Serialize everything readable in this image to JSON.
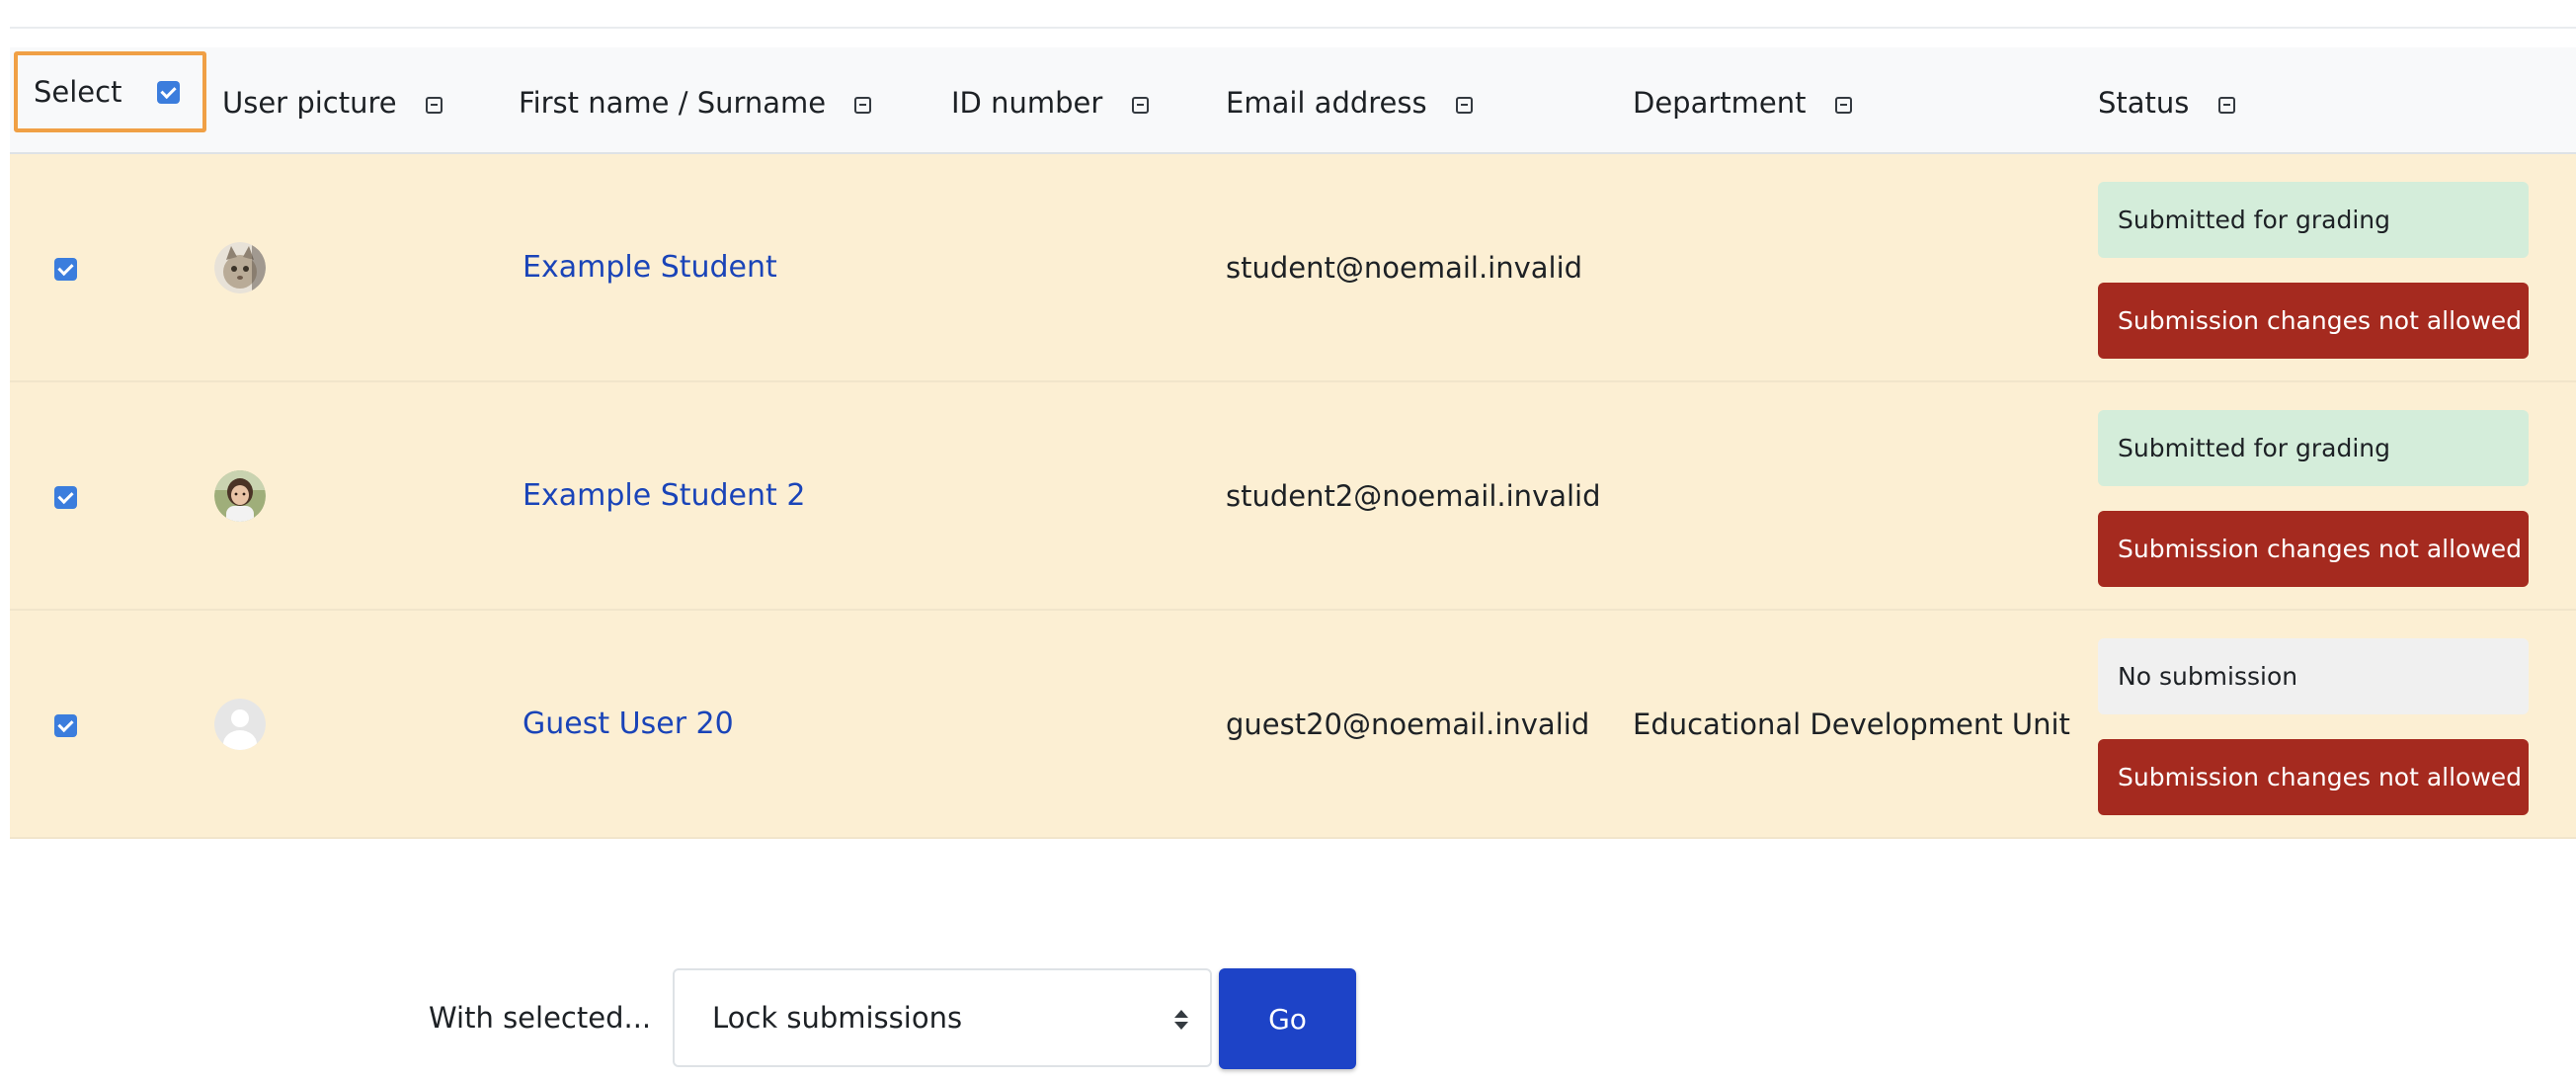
{
  "table": {
    "headers": {
      "select": "Select",
      "user_picture": "User picture",
      "name": "First name / Surname",
      "id_number": "ID number",
      "email": "Email address",
      "department": "Department",
      "status": "Status"
    },
    "rows": [
      {
        "name": "Example Student",
        "id_number": "",
        "email": "student@noemail.invalid",
        "department": "",
        "status": "Submitted for grading",
        "lock": "Submission changes not allowed",
        "avatar": "cat-avatar"
      },
      {
        "name": "Example Student 2",
        "id_number": "",
        "email": "student2@noemail.invalid",
        "department": "",
        "status": "Submitted for grading",
        "lock": "Submission changes not allowed",
        "avatar": "person-avatar"
      },
      {
        "name": "Guest User 20",
        "id_number": "",
        "email": "guest20@noemail.invalid",
        "department": "Educational Development Unit",
        "status": "No submission",
        "lock": "Submission changes not allowed",
        "avatar": "default-user-avatar"
      }
    ]
  },
  "bulk_actions": {
    "label": "With selected...",
    "selected_option": "Lock submissions",
    "go_label": "Go"
  },
  "colors": {
    "row_highlight": "#fcefd3",
    "submitted_badge": "#d4edda",
    "no_submission_badge": "#f0f0f0",
    "locked_badge": "#a52a1f",
    "link": "#1a44b8",
    "go_button": "#1d43c7",
    "select_focus_border": "#f0a045"
  }
}
